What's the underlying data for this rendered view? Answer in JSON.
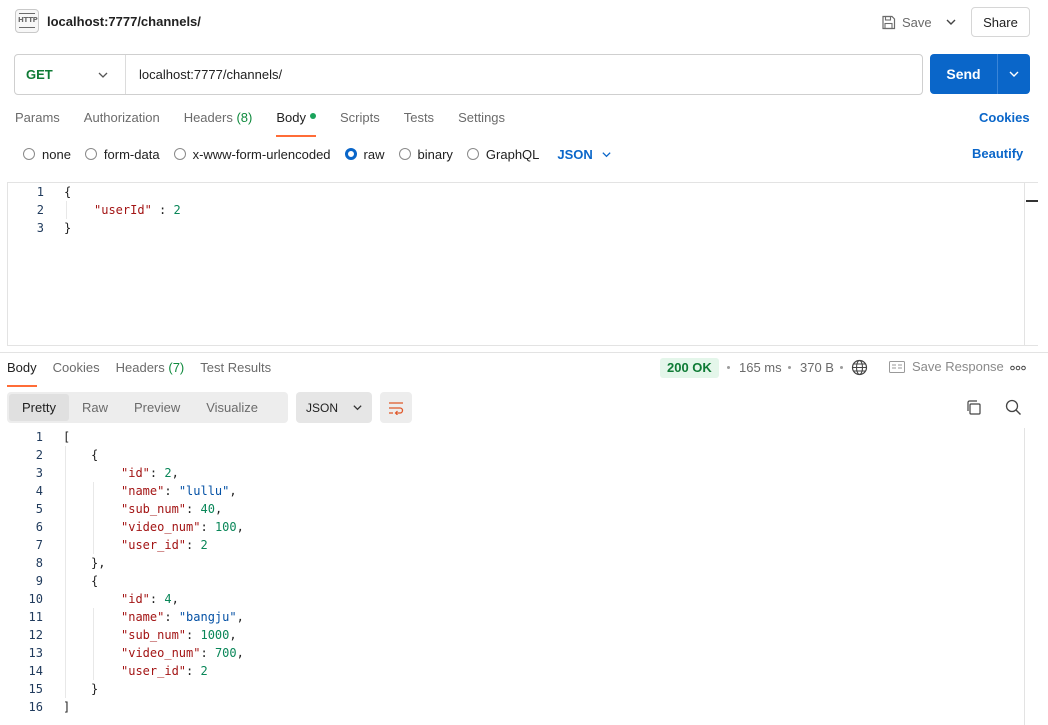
{
  "header": {
    "title": "localhost:7777/channels/",
    "icon_label": "HTTP",
    "save_label": "Save",
    "share_label": "Share"
  },
  "request": {
    "method": "GET",
    "url": "localhost:7777/channels/",
    "send_label": "Send"
  },
  "request_tabs": [
    {
      "label": "Params"
    },
    {
      "label": "Authorization"
    },
    {
      "label": "Headers",
      "count": "(8)"
    },
    {
      "label": "Body",
      "active": true
    },
    {
      "label": "Scripts"
    },
    {
      "label": "Tests"
    },
    {
      "label": "Settings"
    }
  ],
  "cookies_label": "Cookies",
  "body_types": [
    {
      "label": "none"
    },
    {
      "label": "form-data"
    },
    {
      "label": "x-www-form-urlencoded"
    },
    {
      "label": "raw",
      "selected": true
    },
    {
      "label": "binary"
    },
    {
      "label": "GraphQL"
    }
  ],
  "body_format": "JSON",
  "beautify_label": "Beautify",
  "request_body": {
    "line_numbers": [
      "1",
      "2",
      "3"
    ],
    "key": "\"userId\"",
    "colon": " : ",
    "value": "2",
    "open": "{",
    "close": "}"
  },
  "response_tabs": [
    {
      "label": "Body",
      "active": true
    },
    {
      "label": "Cookies"
    },
    {
      "label": "Headers",
      "count": "(7)"
    },
    {
      "label": "Test Results"
    }
  ],
  "response_meta": {
    "status": "200 OK",
    "time": "165 ms",
    "size": "370 B",
    "save_response_label": "Save Response"
  },
  "view_modes": [
    {
      "label": "Pretty",
      "active": true
    },
    {
      "label": "Raw"
    },
    {
      "label": "Preview"
    },
    {
      "label": "Visualize"
    }
  ],
  "response_format": "JSON",
  "response_body": {
    "line_numbers": [
      "1",
      "2",
      "3",
      "4",
      "5",
      "6",
      "7",
      "8",
      "9",
      "10",
      "11",
      "12",
      "13",
      "14",
      "15",
      "16"
    ],
    "items": [
      {
        "id": "2",
        "name": "\"lullu\"",
        "sub_num": "40",
        "video_num": "100",
        "user_id": "2"
      },
      {
        "id": "4",
        "name": "\"bangju\"",
        "sub_num": "1000",
        "video_num": "700",
        "user_id": "2"
      }
    ],
    "keys": {
      "id": "\"id\"",
      "name": "\"name\"",
      "sub_num": "\"sub_num\"",
      "video_num": "\"video_num\"",
      "user_id": "\"user_id\""
    }
  }
}
